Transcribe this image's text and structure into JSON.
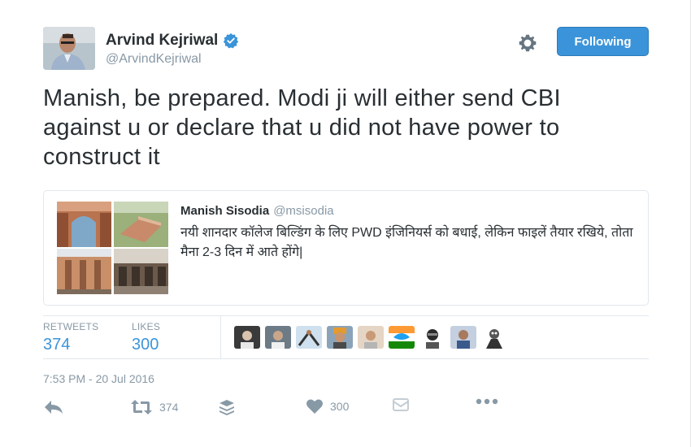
{
  "author": {
    "name": "Arvind Kejriwal",
    "handle": "@ArvindKejriwal"
  },
  "follow_button": "Following",
  "tweet_text": "Manish, be prepared. Modi ji will either send CBI against u or declare that u did not have power to construct it",
  "quoted_tweet": {
    "name": "Manish Sisodia",
    "handle": "@msisodia",
    "text": "नयी शानदार कॉलेज बिल्डिंग के लिए PWD इंजिनियर्स को बधाई, लेकिन फाइलें तैयार रखिये, तोता मैना 2-3 दिन में आते होंगे|"
  },
  "stats": {
    "retweets_label": "RETWEETS",
    "retweets_value": "374",
    "likes_label": "LIKES",
    "likes_value": "300"
  },
  "timestamp": "7:53 PM - 20 Jul 2016",
  "actions": {
    "retweet_count": "374",
    "like_count": "300"
  },
  "colors": {
    "accent": "#3b94d9",
    "muted": "#8899a6",
    "text": "#292f33",
    "border": "#e1e8ed"
  }
}
